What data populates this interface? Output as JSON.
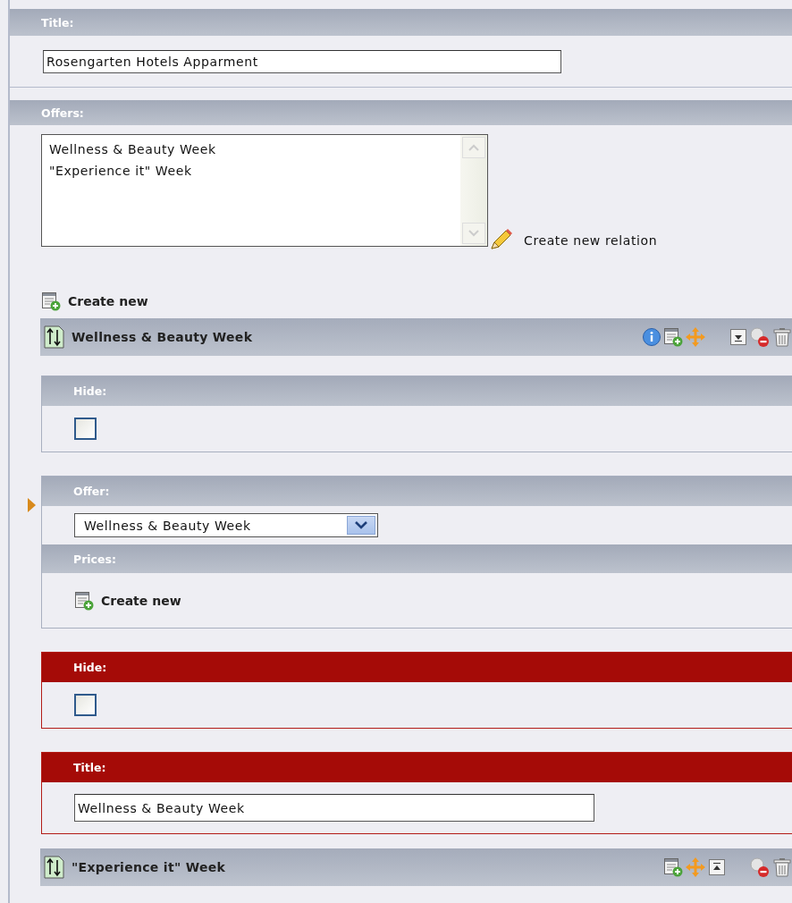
{
  "title_field": {
    "label": "Title:",
    "value": "Rosengarten Hotels Apparment"
  },
  "offers": {
    "label": "Offers:",
    "items": [
      "Wellness & Beauty Week",
      "\"Experience it\" Week"
    ],
    "create_relation": "Create new relation"
  },
  "create_new": "Create new",
  "records": [
    {
      "title": "Wellness & Beauty Week",
      "action_groups": [
        [
          {
            "kind": "info"
          },
          {
            "kind": "new"
          },
          {
            "kind": "move"
          }
        ],
        [
          {
            "kind": "down"
          },
          {
            "kind": "hide"
          },
          {
            "kind": "delete"
          }
        ]
      ],
      "fields": [
        {
          "kind": "checkbox",
          "label": "Hide:",
          "checked": false,
          "error": false
        },
        {
          "kind": "select",
          "label": "Offer:",
          "value": "Wellness & Beauty Week",
          "pointer": true,
          "sub_label": "Prices:",
          "create_new": "Create new"
        },
        {
          "kind": "checkbox",
          "label": "Hide:",
          "checked": false,
          "error": true
        },
        {
          "kind": "text",
          "label": "Title:",
          "value": "Wellness & Beauty Week",
          "error": true
        }
      ]
    },
    {
      "title": "\"Experience it\" Week",
      "action_groups": [
        [
          {
            "kind": "new"
          },
          {
            "kind": "move"
          },
          {
            "kind": "up"
          }
        ],
        [
          {
            "kind": "hide"
          },
          {
            "kind": "delete"
          }
        ]
      ]
    }
  ]
}
